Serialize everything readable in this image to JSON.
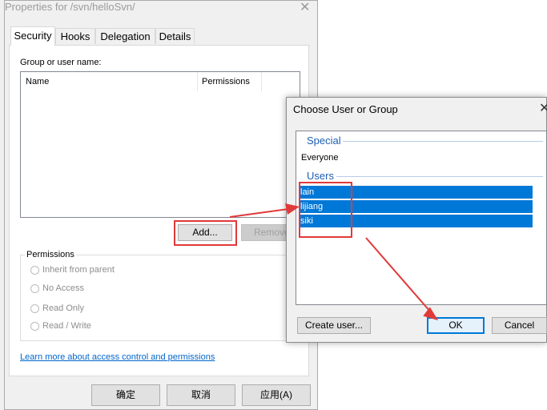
{
  "properties_dialog": {
    "title": "Properties for /svn/helloSvn/",
    "close_glyph": "✕",
    "tabs": [
      "Security",
      "Hooks",
      "Delegation",
      "Details"
    ],
    "group_label": "Group or user name:",
    "columns": [
      "Name",
      "Permissions"
    ],
    "add_button": "Add...",
    "remove_button": "Remove",
    "permissions_group": {
      "title": "Permissions",
      "options": [
        "Inherit from parent",
        "No Access",
        "Read Only",
        "Read / Write"
      ]
    },
    "learn_more_link": "Learn more about access control and permissions",
    "footer_buttons": [
      "确定",
      "取消",
      "应用(A)"
    ]
  },
  "choose_dialog": {
    "title": "Choose User or Group",
    "close_glyph": "✕",
    "special_header": "Special",
    "special_items": [
      "Everyone"
    ],
    "users_header": "Users",
    "users": [
      "lain",
      "lijiang",
      "siki"
    ],
    "create_user_button": "Create user...",
    "ok_button": "OK",
    "cancel_button": "Cancel"
  },
  "colors": {
    "selection": "#0078d7",
    "annotation": "#e03a3a",
    "group_header": "#1e5fb3"
  }
}
